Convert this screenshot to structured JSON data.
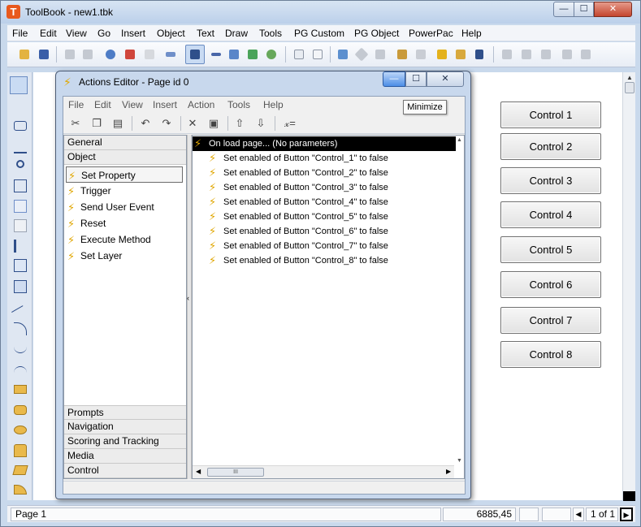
{
  "window": {
    "title": "ToolBook - new1.tbk",
    "app_icon_letter": "T",
    "minimize_glyph": "—",
    "maximize_glyph": "☐",
    "close_glyph": "✕"
  },
  "menubar": [
    "File",
    "Edit",
    "View",
    "Go",
    "Insert",
    "Object",
    "Text",
    "Draw",
    "Tools",
    "PG Custom",
    "PG Object",
    "PowerPac",
    "Help"
  ],
  "page_buttons": [
    "Control 1",
    "Control 2",
    "Control 3",
    "Control 4",
    "Control 5",
    "Control 6",
    "Control 7",
    "Control 8"
  ],
  "statusbar": {
    "page": "Page 1",
    "coords": "6885,45",
    "page_count": "1 of 1"
  },
  "actions_editor": {
    "title": "Actions Editor - Page id 0",
    "tooltip": "Minimize",
    "menu": [
      "File",
      "Edit",
      "View",
      "Insert",
      "Action",
      "Tools",
      "Help"
    ],
    "toolbar_glyphs": {
      "formula": "𝓍="
    },
    "categories_top": [
      "General",
      "Object"
    ],
    "object_items": [
      "Set Property",
      "Trigger",
      "Send User Event",
      "Reset",
      "Execute Method",
      "Set Layer"
    ],
    "categories_bottom": [
      "Prompts",
      "Navigation",
      "Scoring and Tracking",
      "Media",
      "Control"
    ],
    "event_row": "On load page... (No parameters)",
    "actions": [
      "Set enabled of Button \"Control_1\" to false",
      "Set enabled of Button \"Control_2\" to false",
      "Set enabled of Button \"Control_3\" to false",
      "Set enabled of Button \"Control_4\" to false",
      "Set enabled of Button \"Control_5\" to false",
      "Set enabled of Button \"Control_6\" to false",
      "Set enabled of Button \"Control_7\" to false",
      "Set enabled of Button \"Control_8\" to false"
    ],
    "hscroll_thumb_glyph": "III"
  },
  "colors": {
    "frame": "#c9d9ec",
    "selection": "#000000",
    "bolt": "#e0a600",
    "close_red": "#c4452e"
  }
}
